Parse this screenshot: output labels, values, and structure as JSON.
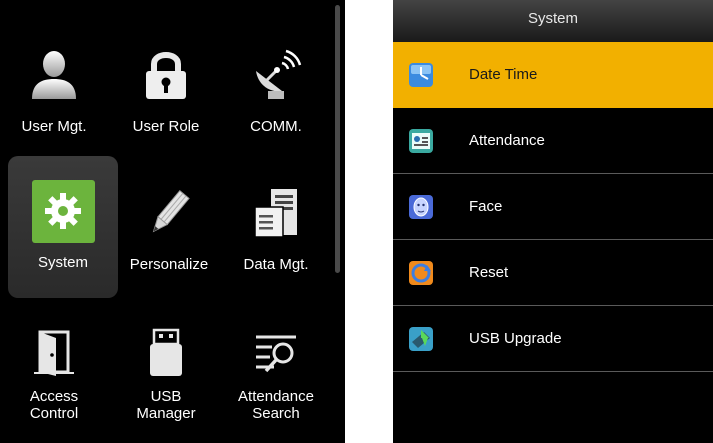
{
  "main_menu": {
    "tiles": [
      {
        "label": "User Mgt.",
        "icon": "user-icon"
      },
      {
        "label": "User Role",
        "icon": "lock-icon"
      },
      {
        "label": "COMM.",
        "icon": "satellite-dish-icon"
      },
      {
        "label": "System",
        "icon": "gear-icon",
        "selected": true
      },
      {
        "label": "Personalize",
        "icon": "pencil-icon"
      },
      {
        "label": "Data Mgt.",
        "icon": "data-management-icon"
      },
      {
        "label": "Access\nControl",
        "icon": "door-icon"
      },
      {
        "label": "USB\nManager",
        "icon": "usb-drive-icon"
      },
      {
        "label": "Attendance\nSearch",
        "icon": "attendance-search-icon"
      }
    ]
  },
  "system_menu": {
    "title": "System",
    "items": [
      {
        "label": "Date Time",
        "icon": "clock-icon",
        "selected": true
      },
      {
        "label": "Attendance",
        "icon": "attendance-icon"
      },
      {
        "label": "Face",
        "icon": "face-icon"
      },
      {
        "label": "Reset",
        "icon": "reset-icon"
      },
      {
        "label": "USB Upgrade",
        "icon": "usb-upgrade-icon"
      }
    ]
  },
  "colors": {
    "selected_row": "#f2b000",
    "selected_tile_icon_bg": "#6cb43d",
    "background": "#000000"
  }
}
